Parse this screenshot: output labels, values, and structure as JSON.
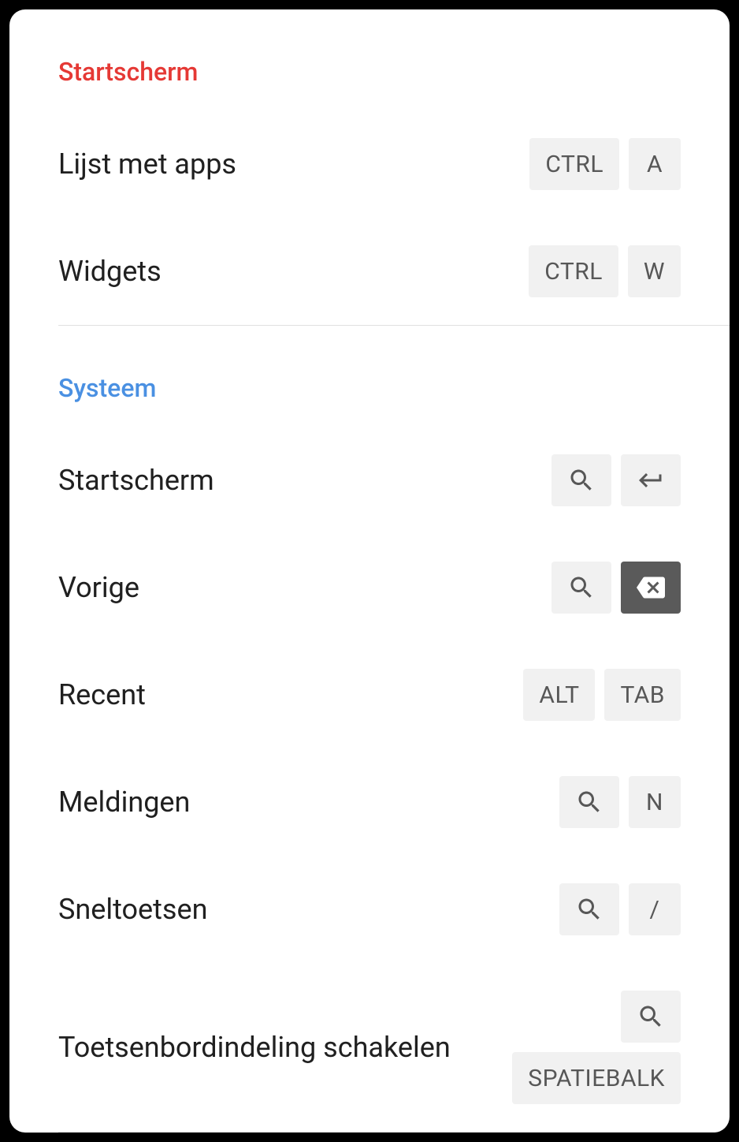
{
  "sections": [
    {
      "title": "Startscherm",
      "color": "red",
      "items": [
        {
          "label": "Lijst met apps",
          "keys": [
            {
              "type": "text",
              "value": "CTRL"
            },
            {
              "type": "text",
              "value": "A"
            }
          ]
        },
        {
          "label": "Widgets",
          "keys": [
            {
              "type": "text",
              "value": "CTRL"
            },
            {
              "type": "text",
              "value": "W"
            }
          ]
        }
      ]
    },
    {
      "title": "Systeem",
      "color": "blue",
      "items": [
        {
          "label": "Startscherm",
          "keys": [
            {
              "type": "icon",
              "value": "search"
            },
            {
              "type": "icon",
              "value": "enter"
            }
          ]
        },
        {
          "label": "Vorige",
          "keys": [
            {
              "type": "icon",
              "value": "search"
            },
            {
              "type": "icon",
              "value": "backspace",
              "dark": true
            }
          ]
        },
        {
          "label": "Recent",
          "keys": [
            {
              "type": "text",
              "value": "ALT"
            },
            {
              "type": "text",
              "value": "TAB"
            }
          ]
        },
        {
          "label": "Meldingen",
          "keys": [
            {
              "type": "icon",
              "value": "search"
            },
            {
              "type": "text",
              "value": "N"
            }
          ]
        },
        {
          "label": "Sneltoetsen",
          "keys": [
            {
              "type": "icon",
              "value": "search"
            },
            {
              "type": "text",
              "value": "/"
            }
          ]
        },
        {
          "label": "Toetsenbordindeling schakelen",
          "keys": [
            {
              "type": "icon",
              "value": "search"
            },
            {
              "type": "text",
              "value": "SPATIEBALK"
            }
          ],
          "stacked": true
        }
      ]
    }
  ]
}
